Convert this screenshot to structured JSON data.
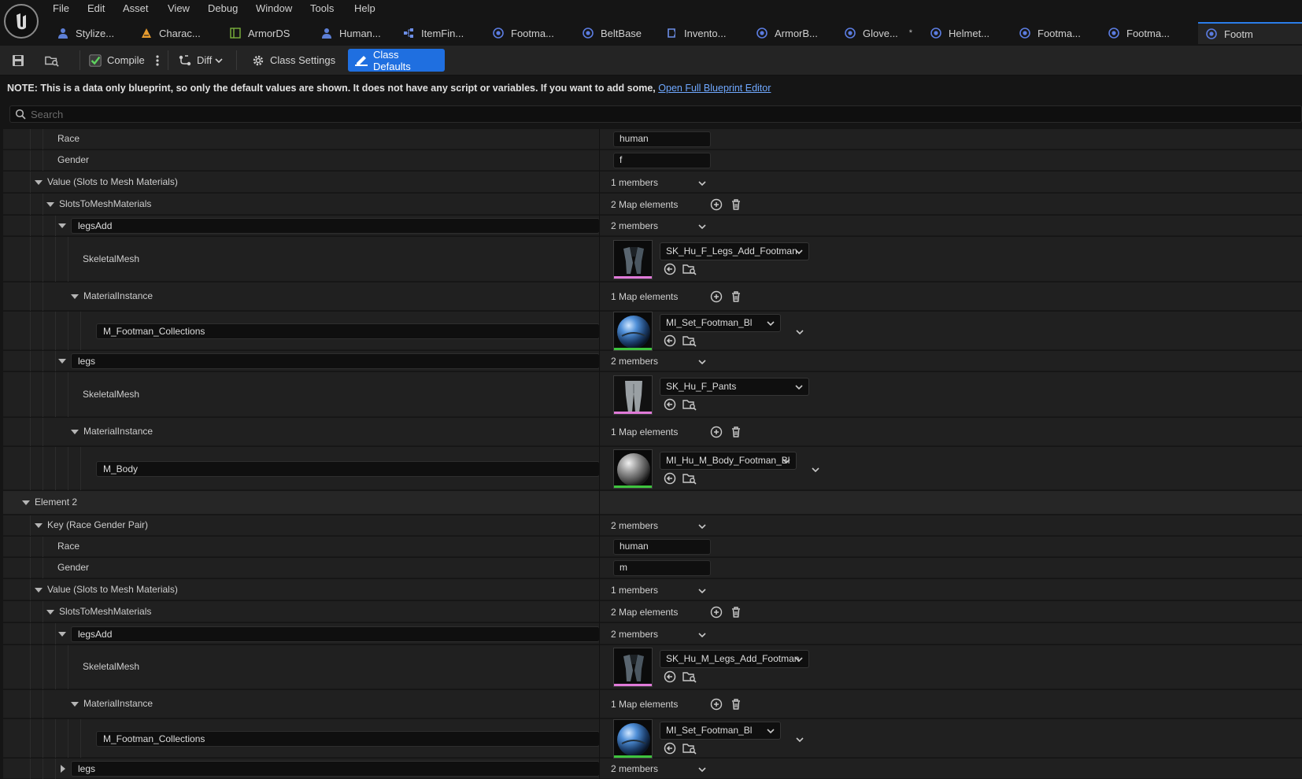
{
  "menu": [
    "File",
    "Edit",
    "Asset",
    "View",
    "Debug",
    "Window",
    "Tools",
    "Help"
  ],
  "tabs": [
    {
      "label": "Stylize...",
      "icon": "character-icon"
    },
    {
      "label": "Charac...",
      "icon": "warning-cone-icon"
    },
    {
      "label": "ArmorDS",
      "icon": "datatable-icon"
    },
    {
      "label": "Human...",
      "icon": "character-icon"
    },
    {
      "label": "ItemFin...",
      "icon": "node-graph-icon"
    },
    {
      "label": "Footma...",
      "icon": "blueprint-icon"
    },
    {
      "label": "BeltBase",
      "icon": "blueprint-icon"
    },
    {
      "label": "Invento...",
      "icon": "widget-icon"
    },
    {
      "label": "ArmorB...",
      "icon": "blueprint-icon"
    },
    {
      "label": "Glove...",
      "icon": "blueprint-icon",
      "dirty": "*"
    },
    {
      "label": "Helmet...",
      "icon": "blueprint-icon"
    },
    {
      "label": "Footma...",
      "icon": "blueprint-icon"
    },
    {
      "label": "Footma...",
      "icon": "blueprint-icon"
    },
    {
      "label": "Footm",
      "icon": "blueprint-icon",
      "active": true
    }
  ],
  "toolbar": {
    "compile": "Compile",
    "diff": "Diff",
    "class_settings": "Class Settings",
    "class_defaults": "Class Defaults"
  },
  "note": {
    "text": "NOTE: This is a data only blueprint, so only the default values are shown.  It does not have any script or variables.  If you want to add some, ",
    "link": "Open Full Blueprint Editor"
  },
  "search": {
    "placeholder": "Search"
  },
  "colors": {
    "accent": "#1f6fe0",
    "mesh_bar": "#e07ad8",
    "material_bar": "#3ec43e"
  },
  "rows": [
    {
      "kind": "field",
      "label": "Race",
      "value": "human"
    },
    {
      "kind": "field",
      "label": "Gender",
      "value": "f"
    },
    {
      "kind": "group",
      "label": "Value (Slots to Mesh Materials)",
      "summary": "1 members"
    },
    {
      "kind": "map",
      "label": "SlotsToMeshMaterials",
      "summary": "2 Map elements"
    },
    {
      "kind": "key",
      "label": "legsAdd",
      "summary": "2 members"
    },
    {
      "kind": "asset",
      "label": "SkeletalMesh",
      "asset": "SK_Hu_F_Legs_Add_Footman",
      "thumb": "legs-add"
    },
    {
      "kind": "map",
      "label": "MaterialInstance",
      "summary": "1 Map elements"
    },
    {
      "kind": "matkey",
      "label": "M_Footman_Collections",
      "asset": "MI_Set_Footman_Bl",
      "thumb": "sphere-blue"
    },
    {
      "kind": "key",
      "label": "legs",
      "summary": "2 members"
    },
    {
      "kind": "asset",
      "label": "SkeletalMesh",
      "asset": "SK_Hu_F_Pants",
      "thumb": "pants"
    },
    {
      "kind": "map",
      "label": "MaterialInstance",
      "summary": "1 Map elements"
    },
    {
      "kind": "matkey",
      "label": "M_Body",
      "asset": "MI_Hu_M_Body_Footman_Bl",
      "thumb": "sphere-grey"
    },
    {
      "kind": "element",
      "label": "Element 2"
    },
    {
      "kind": "group",
      "label": "Key (Race Gender Pair)",
      "summary": "2 members"
    },
    {
      "kind": "field",
      "label": "Race",
      "value": "human"
    },
    {
      "kind": "field",
      "label": "Gender",
      "value": "m"
    },
    {
      "kind": "group",
      "label": "Value (Slots to Mesh Materials)",
      "summary": "1 members"
    },
    {
      "kind": "map",
      "label": "SlotsToMeshMaterials",
      "summary": "2 Map elements"
    },
    {
      "kind": "key",
      "label": "legsAdd",
      "summary": "2 members"
    },
    {
      "kind": "asset",
      "label": "SkeletalMesh",
      "asset": "SK_Hu_M_Legs_Add_Footman",
      "thumb": "legs-add"
    },
    {
      "kind": "map",
      "label": "MaterialInstance",
      "summary": "1 Map elements"
    },
    {
      "kind": "matkey",
      "label": "M_Footman_Collections",
      "asset": "MI_Set_Footman_Bl",
      "thumb": "sphere-blue"
    },
    {
      "kind": "key",
      "label": "legs",
      "summary": "2 members",
      "collapsed": true
    }
  ]
}
